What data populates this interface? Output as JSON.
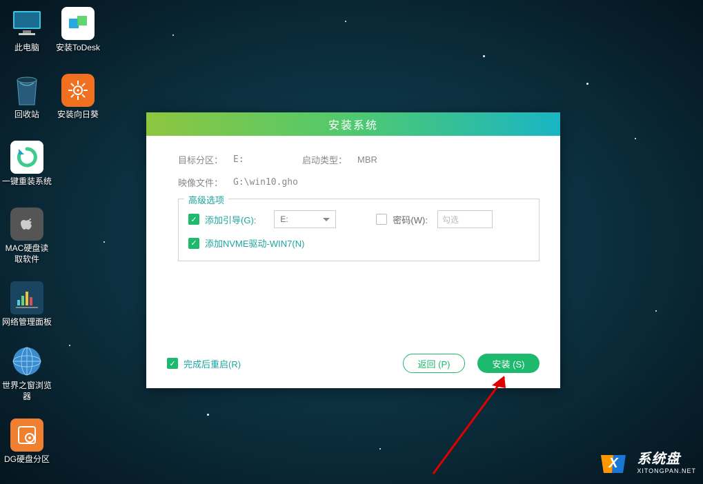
{
  "desktop": {
    "icons": [
      {
        "name": "此电脑"
      },
      {
        "name": "安装ToDesk"
      },
      {
        "name": "回收站"
      },
      {
        "name": "安装向日葵"
      },
      {
        "name": "一键重装系统"
      },
      {
        "name": "MAC硬盘读取软件"
      },
      {
        "name": "网络管理面板"
      },
      {
        "name": "世界之窗浏览器"
      },
      {
        "name": "DG硬盘分区"
      }
    ]
  },
  "dialog": {
    "title": "安装系统",
    "target_partition_label": "目标分区：",
    "target_partition_value": "E:",
    "boot_type_label": "启动类型：",
    "boot_type_value": "MBR",
    "image_file_label": "映像文件：",
    "image_file_value": "G:\\win10.gho",
    "advanced_legend": "高级选项",
    "add_boot_label": "添加引导(G):",
    "add_boot_select": "E:",
    "password_label": "密码(W):",
    "password_placeholder": "勾选",
    "nvme_label": "添加NVME驱动-WIN7(N)",
    "restart_label": "完成后重启(R)",
    "back_btn": "返回 (P)",
    "install_btn": "安装 (S)"
  },
  "watermark": {
    "title": "系统盘",
    "url": "XITONGPAN.NET"
  }
}
